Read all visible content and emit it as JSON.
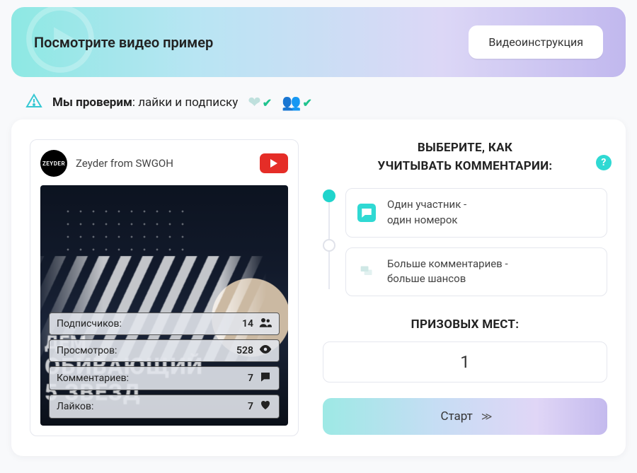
{
  "banner": {
    "title": "Посмотрите видео пример",
    "button": "Видеоинструкция"
  },
  "verify": {
    "label_bold": "Мы проверим",
    "label_rest": ": лайки и подписку"
  },
  "channel": {
    "avatar_text": "ZEYDER",
    "name": "Zeyder from SWGOH"
  },
  "thumb_text": {
    "l1": "ДЕМ",
    "l2": "ОБИВАЮЩИЙ",
    "l3": "5 ЗВЕЗД"
  },
  "stats": [
    {
      "label": "Подписчиков:",
      "value": "14",
      "icon": "users"
    },
    {
      "label": "Просмотров:",
      "value": "528",
      "icon": "eye"
    },
    {
      "label": "Комментариев:",
      "value": "7",
      "icon": "comment"
    },
    {
      "label": "Лайков:",
      "value": "7",
      "icon": "heart"
    }
  ],
  "right": {
    "heading_l1": "ВЫБЕРИТЕ, КАК",
    "heading_l2": "УЧИТЫВАТЬ КОММЕНТАРИИ:",
    "options": [
      {
        "icon": "comment",
        "l1": "Один участник -",
        "l2": "один номерок",
        "selected": true
      },
      {
        "icon": "comments",
        "l1": "Больше комментариев -",
        "l2": "больше шансов",
        "selected": false
      }
    ],
    "prizes_label": "ПРИЗОВЫХ МЕСТ:",
    "prizes_value": "1",
    "start": "Старт"
  }
}
